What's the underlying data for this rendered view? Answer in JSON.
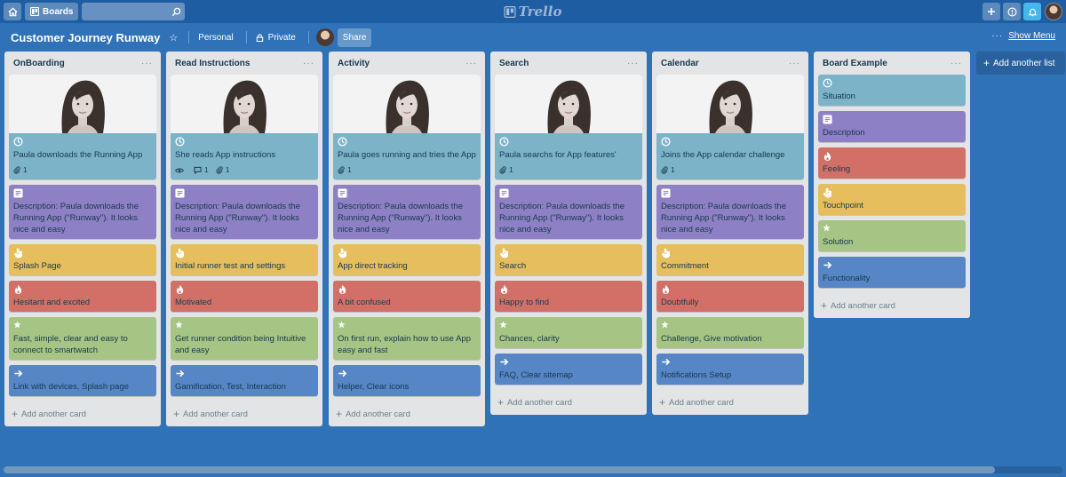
{
  "header": {
    "home_icon": "home-icon",
    "boards_label": "Boards",
    "search_placeholder": "",
    "logo_text": "Trello",
    "right_icons": [
      "plus-icon",
      "info-icon",
      "bell-icon"
    ]
  },
  "board": {
    "title": "Customer Journey Runway",
    "team_label": "Personal",
    "visibility_label": "Private",
    "share_label": "Share",
    "show_menu_dots": "···",
    "show_menu_label": "Show Menu"
  },
  "lists": [
    {
      "title": "OnBoarding",
      "cards": [
        {
          "type": "situation",
          "cover": true,
          "text": "Paula downloads the Running App",
          "badges": [
            {
              "icon": "attachment-icon",
              "count": "1"
            }
          ]
        },
        {
          "type": "desc",
          "text": "Description: Paula downloads the Running App (\"Runway\"). It looks nice and easy"
        },
        {
          "type": "touch",
          "text": "Splash Page"
        },
        {
          "type": "feel",
          "text": "Hesitant and excited"
        },
        {
          "type": "sol",
          "text": "Fast, simple, clear and easy to connect to smartwatch"
        },
        {
          "type": "func",
          "text": "Link with devices, Splash page"
        }
      ],
      "add_card": "Add another card"
    },
    {
      "title": "Read Instructions",
      "cards": [
        {
          "type": "situation",
          "cover": true,
          "text": "She reads App instructions",
          "badges": [
            {
              "icon": "eye-icon",
              "count": ""
            },
            {
              "icon": "comment-icon",
              "count": "1"
            },
            {
              "icon": "attachment-icon",
              "count": "1"
            }
          ]
        },
        {
          "type": "desc",
          "text": "Description: Paula downloads the Running App (\"Runway\"). It looks nice and easy"
        },
        {
          "type": "touch",
          "text": "Initial runner test and settings"
        },
        {
          "type": "feel",
          "text": "Motivated"
        },
        {
          "type": "sol",
          "text": "Get runner condition being Intuitive and easy"
        },
        {
          "type": "func",
          "text": "Gamification, Test, Interaction"
        }
      ],
      "add_card": "Add another card"
    },
    {
      "title": "Activity",
      "cards": [
        {
          "type": "situation",
          "cover": true,
          "text": "Paula goes running and tries the App",
          "badges": [
            {
              "icon": "attachment-icon",
              "count": "1"
            }
          ]
        },
        {
          "type": "desc",
          "text": "Description: Paula downloads the Running App (\"Runway\"). It looks nice and easy"
        },
        {
          "type": "touch",
          "text": "App direct tracking"
        },
        {
          "type": "feel",
          "text": "A bit confused"
        },
        {
          "type": "sol",
          "text": "On first run, explain how to use App easy and fast"
        },
        {
          "type": "func",
          "text": "Helper, Clear icons"
        }
      ],
      "add_card": "Add another card"
    },
    {
      "title": "Search",
      "cards": [
        {
          "type": "situation",
          "cover": true,
          "text": "Paula searchs for App features'",
          "badges": [
            {
              "icon": "attachment-icon",
              "count": "1"
            }
          ]
        },
        {
          "type": "desc",
          "text": "Description: Paula downloads the Running App (\"Runway\"). It looks nice and easy"
        },
        {
          "type": "touch",
          "text": "Search"
        },
        {
          "type": "feel",
          "text": "Happy to find"
        },
        {
          "type": "sol",
          "text": "Chances, clarity"
        },
        {
          "type": "func",
          "text": "FAQ, Clear sitemap"
        }
      ],
      "add_card": "Add another card"
    },
    {
      "title": "Calendar",
      "cards": [
        {
          "type": "situation",
          "cover": true,
          "text": "Joins the App calendar challenge",
          "badges": [
            {
              "icon": "attachment-icon",
              "count": "1"
            }
          ]
        },
        {
          "type": "desc",
          "text": "Description: Paula downloads the Running App (\"Runway\"). It looks nice and easy"
        },
        {
          "type": "touch",
          "text": "Commitment"
        },
        {
          "type": "feel",
          "text": "Doubtfully"
        },
        {
          "type": "sol",
          "text": "Challenge, Give motivation"
        },
        {
          "type": "func",
          "text": "Notifications Setup"
        }
      ],
      "add_card": "Add another card"
    },
    {
      "title": "Board Example",
      "cards": [
        {
          "type": "situation",
          "text": "Situation"
        },
        {
          "type": "desc",
          "text": "Description"
        },
        {
          "type": "feel",
          "text": "Feeling"
        },
        {
          "type": "touch",
          "text": "Touchpoint"
        },
        {
          "type": "sol",
          "text": "Solution"
        },
        {
          "type": "func",
          "text": "Functionality"
        }
      ],
      "add_card": "Add another card"
    }
  ],
  "add_list_label": "Add another list",
  "colors": {
    "background": "#2f72b8",
    "header": "#1f5da3",
    "situation": "#7cb3c8",
    "description": "#8e80c4",
    "touchpoint": "#e6be5e",
    "feeling": "#d27068",
    "solution": "#a6c483",
    "functionality": "#5786c6"
  }
}
